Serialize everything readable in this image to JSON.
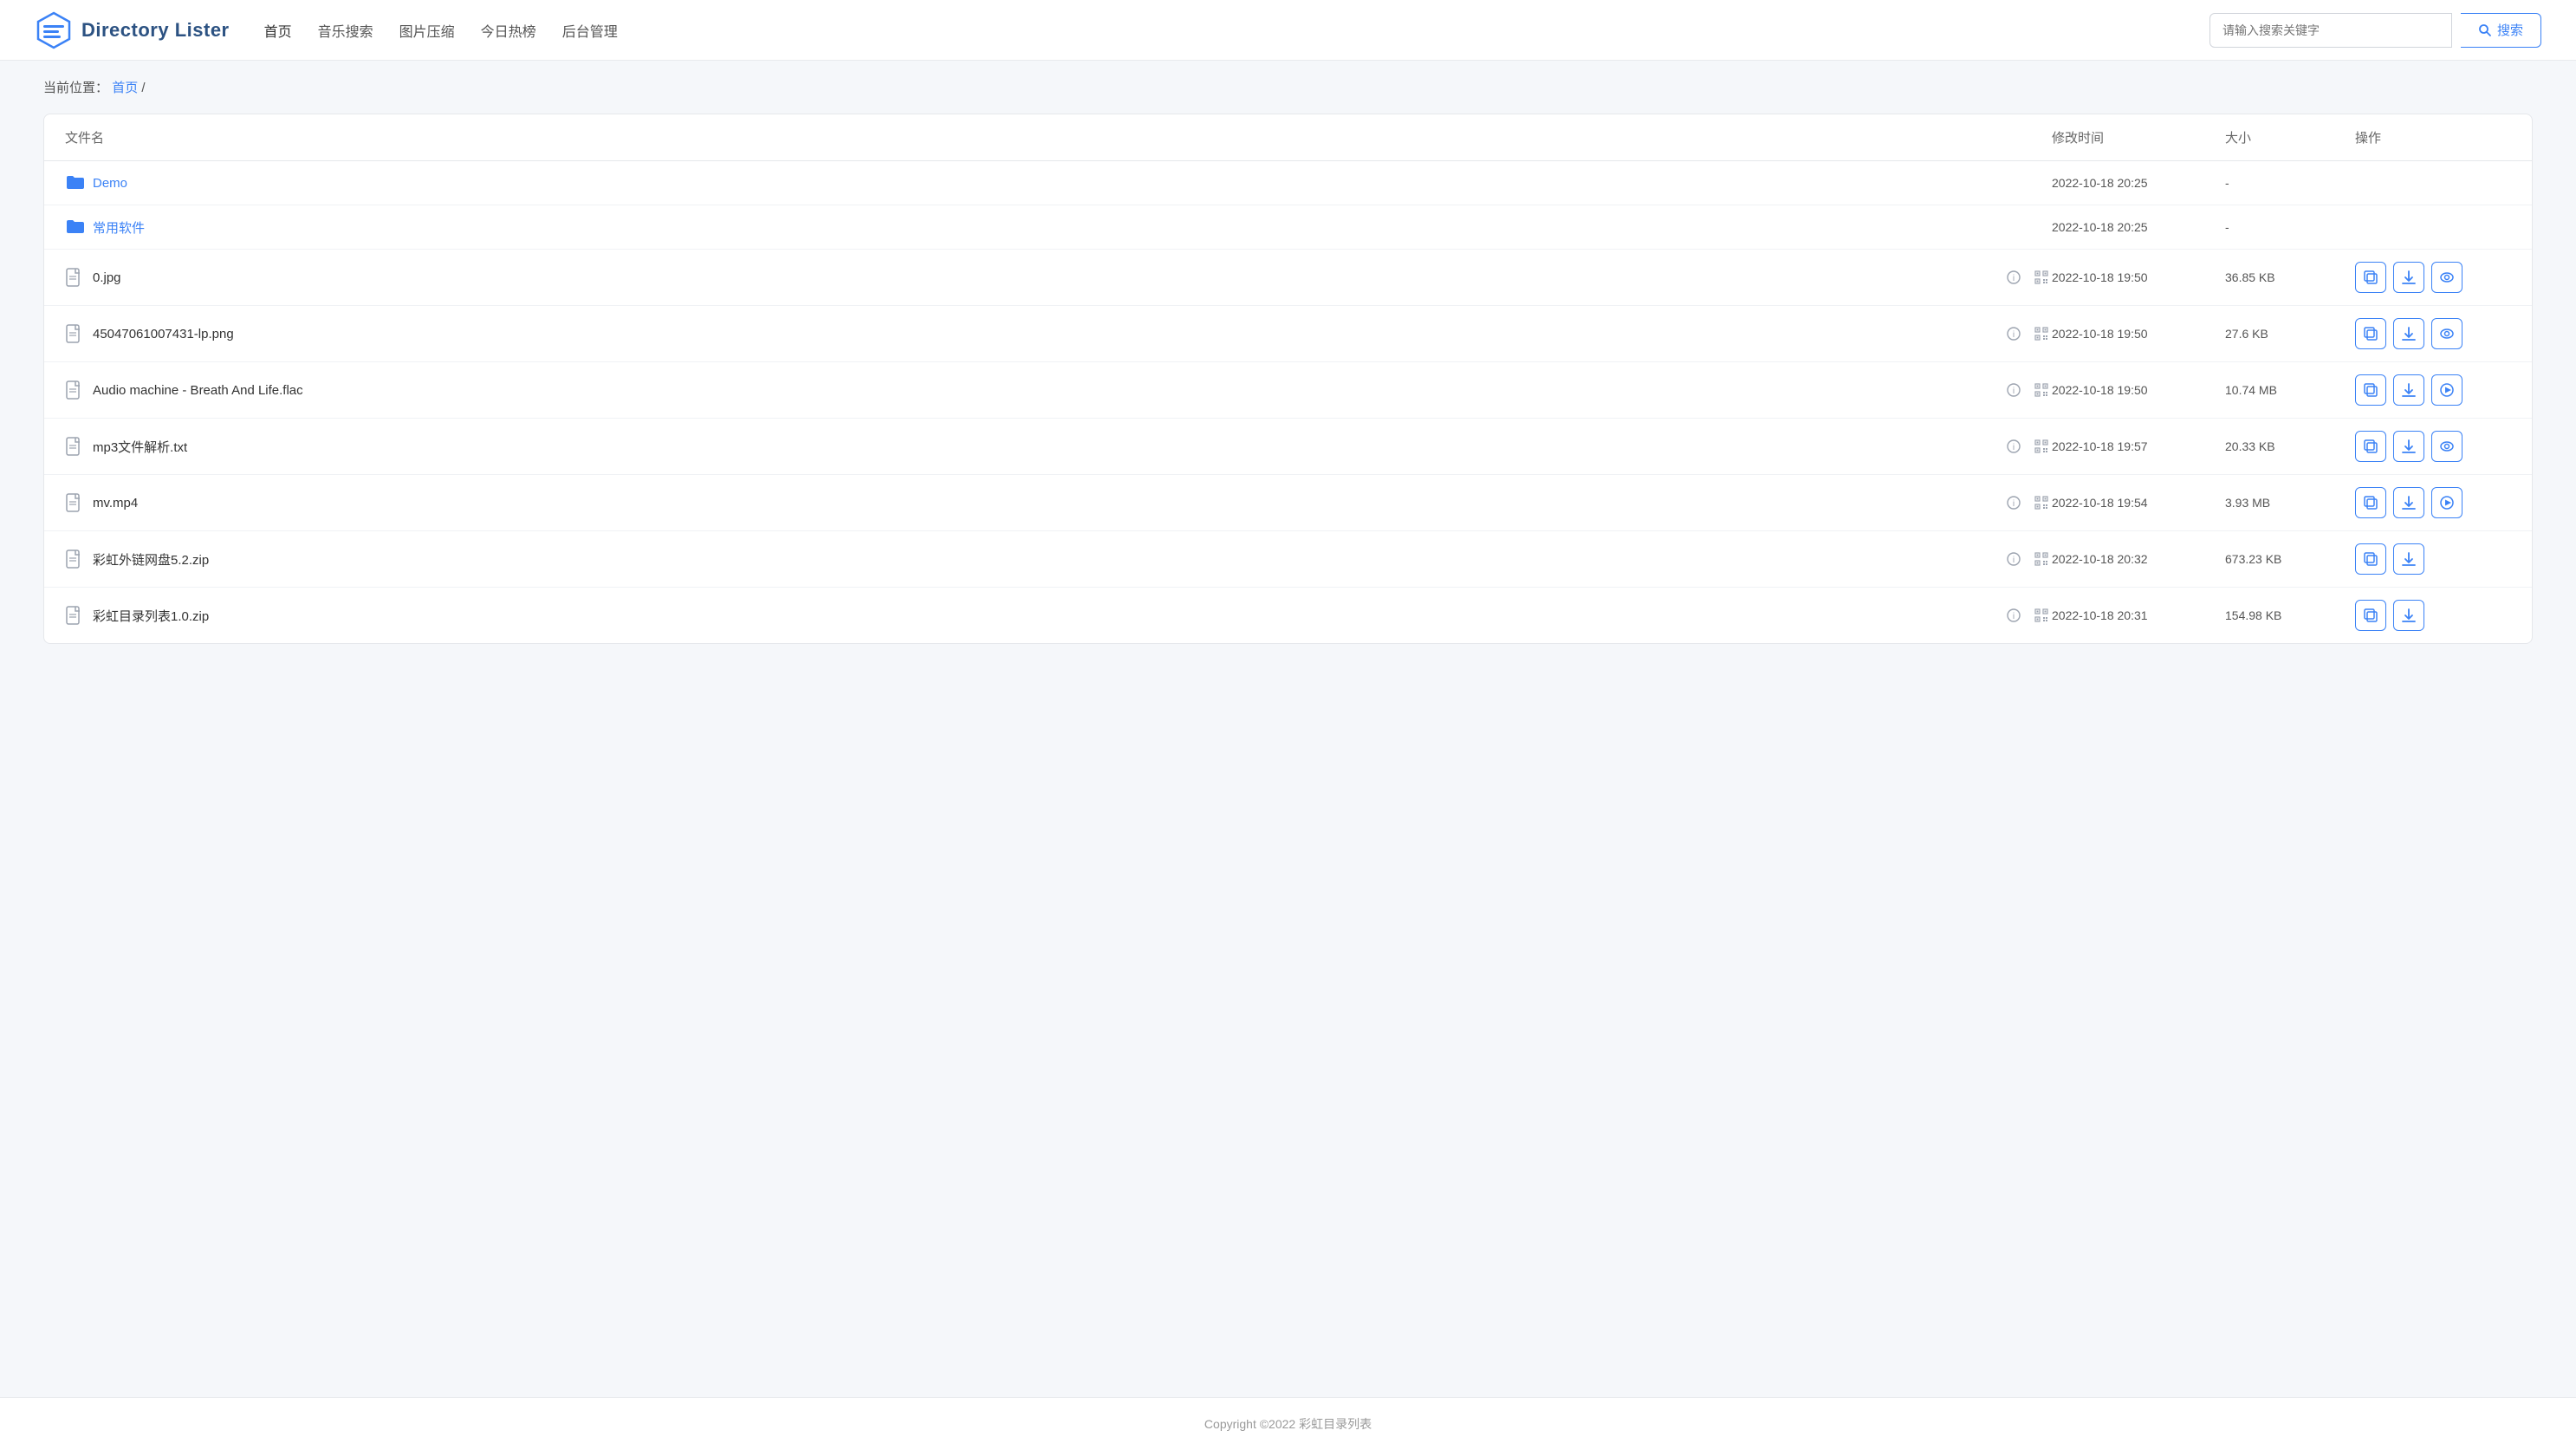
{
  "header": {
    "logo_text": "Directory Lister",
    "nav": [
      {
        "label": "首页",
        "active": true
      },
      {
        "label": "音乐搜索"
      },
      {
        "label": "图片压缩"
      },
      {
        "label": "今日热榜"
      },
      {
        "label": "后台管理"
      }
    ],
    "search_placeholder": "请输入搜索关键字",
    "search_btn_label": "搜索"
  },
  "breadcrumb": {
    "prefix": "当前位置：",
    "home_link": "首页",
    "separator": " /"
  },
  "table": {
    "columns": [
      "文件名",
      "修改时间",
      "大小",
      "操作"
    ],
    "rows": [
      {
        "type": "folder",
        "name": "Demo",
        "modified": "2022-10-18 20:25",
        "size": "-",
        "actions": []
      },
      {
        "type": "folder",
        "name": "常用软件",
        "modified": "2022-10-18 20:25",
        "size": "-",
        "actions": []
      },
      {
        "type": "file",
        "name": "0.jpg",
        "modified": "2022-10-18 19:50",
        "size": "36.85 KB",
        "actions": [
          "copy",
          "download",
          "preview"
        ]
      },
      {
        "type": "file",
        "name": "45047061007431-lp.png",
        "modified": "2022-10-18 19:50",
        "size": "27.6 KB",
        "actions": [
          "copy",
          "download",
          "preview"
        ]
      },
      {
        "type": "file",
        "name": "Audio machine - Breath And Life.flac",
        "modified": "2022-10-18 19:50",
        "size": "10.74 MB",
        "actions": [
          "copy",
          "download",
          "play"
        ]
      },
      {
        "type": "file",
        "name": "mp3文件解析.txt",
        "modified": "2022-10-18 19:57",
        "size": "20.33 KB",
        "actions": [
          "copy",
          "download",
          "preview"
        ]
      },
      {
        "type": "file",
        "name": "mv.mp4",
        "modified": "2022-10-18 19:54",
        "size": "3.93 MB",
        "actions": [
          "copy",
          "download",
          "play"
        ]
      },
      {
        "type": "file",
        "name": "彩虹外链网盘5.2.zip",
        "modified": "2022-10-18 20:32",
        "size": "673.23 KB",
        "actions": [
          "copy",
          "download"
        ]
      },
      {
        "type": "file",
        "name": "彩虹目录列表1.0.zip",
        "modified": "2022-10-18 20:31",
        "size": "154.98 KB",
        "actions": [
          "copy",
          "download"
        ]
      }
    ]
  },
  "footer": {
    "text": "Copyright ©2022 彩虹目录列表"
  }
}
